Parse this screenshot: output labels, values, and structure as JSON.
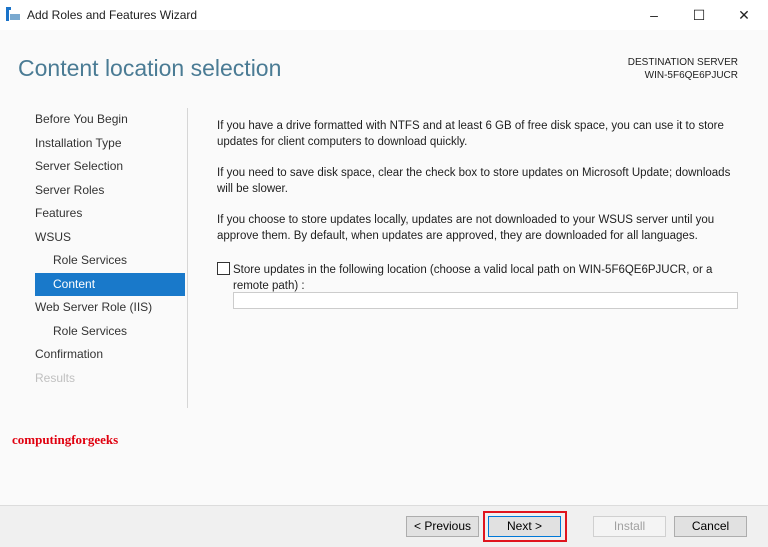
{
  "window": {
    "title": "Add Roles and Features Wizard",
    "minimize": "–",
    "maximize": "☐",
    "close": "✕"
  },
  "header": {
    "page_title": "Content location selection",
    "destination_label": "DESTINATION SERVER",
    "destination_server": "WIN-5F6QE6PJUCR"
  },
  "nav": [
    {
      "label": "Before You Begin"
    },
    {
      "label": "Installation Type"
    },
    {
      "label": "Server Selection"
    },
    {
      "label": "Server Roles"
    },
    {
      "label": "Features"
    },
    {
      "label": "WSUS"
    },
    {
      "label": "Role Services"
    },
    {
      "label": "Content"
    },
    {
      "label": "Web Server Role (IIS)"
    },
    {
      "label": "Role Services"
    },
    {
      "label": "Confirmation"
    },
    {
      "label": "Results"
    }
  ],
  "content": {
    "p1": "If you have a drive formatted with NTFS and at least 6 GB of free disk space, you can use it to store updates for client computers to download quickly.",
    "p2": "If you need to save disk space, clear the check box to store updates on Microsoft Update; downloads will be slower.",
    "p3": "If you choose to store updates locally, updates are not downloaded to your WSUS server until you approve them. By default, when updates are approved, they are downloaded for all languages.",
    "checkbox_label": "Store updates in the following location (choose a valid local path on WIN-5F6QE6PJUCR, or a remote path) :",
    "checkbox_checked": false,
    "path_value": ""
  },
  "watermark": "computingforgeeks",
  "buttons": {
    "previous": "< Previous",
    "next": "Next >",
    "install": "Install",
    "cancel": "Cancel"
  }
}
